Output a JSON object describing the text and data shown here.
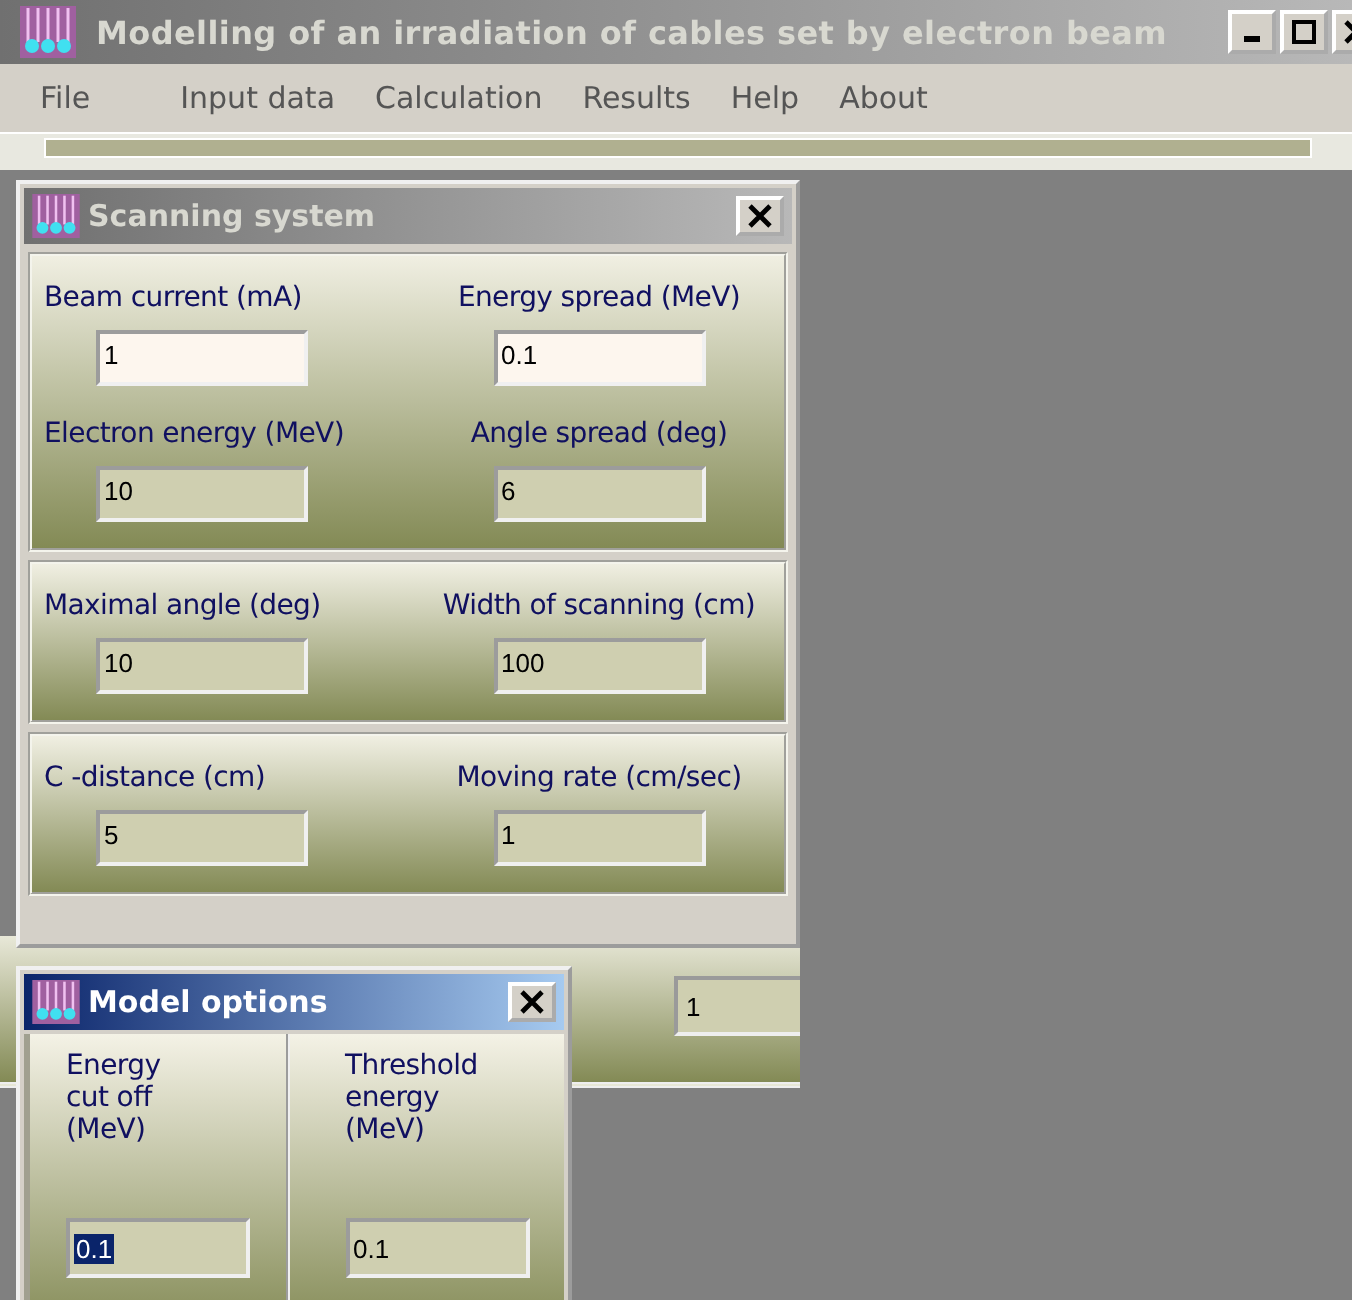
{
  "window": {
    "title": "Modelling of an irradiation of cables set by electron beam",
    "active": false
  },
  "menu": [
    {
      "label": "File"
    },
    {
      "label": "Input data"
    },
    {
      "label": "Calculation"
    },
    {
      "label": "Results"
    },
    {
      "label": "Help"
    },
    {
      "label": "About"
    }
  ],
  "scanning_system": {
    "title": "Scanning system",
    "active": false,
    "groups": [
      {
        "fields": [
          {
            "label": "Beam current (mA)",
            "value": "1",
            "kind": "light"
          },
          {
            "label": "Energy spread (MeV)",
            "value": "0.1",
            "kind": "light"
          },
          {
            "label": "Electron energy (MeV)",
            "value": "10",
            "kind": "dark"
          },
          {
            "label": "Angle spread (deg)",
            "value": "6",
            "kind": "dark"
          }
        ]
      },
      {
        "fields": [
          {
            "label": "Maximal angle (deg)",
            "value": "10",
            "kind": "dark"
          },
          {
            "label": "Width of scanning (cm)",
            "value": "100",
            "kind": "dark"
          }
        ]
      },
      {
        "fields": [
          {
            "label": "C -distance (cm)",
            "value": "5",
            "kind": "dark"
          },
          {
            "label": "Moving rate (cm/sec)",
            "value": "1",
            "kind": "dark"
          }
        ]
      }
    ]
  },
  "background_window": {
    "field_value": "1"
  },
  "model_options": {
    "title": "Model options",
    "active": true,
    "fields": [
      {
        "label": "Energy cut off (MeV)",
        "value": "0.1",
        "text_selected": true
      },
      {
        "label": "Threshold energy (MeV)",
        "value": "0.1",
        "text_selected": false
      }
    ]
  }
}
